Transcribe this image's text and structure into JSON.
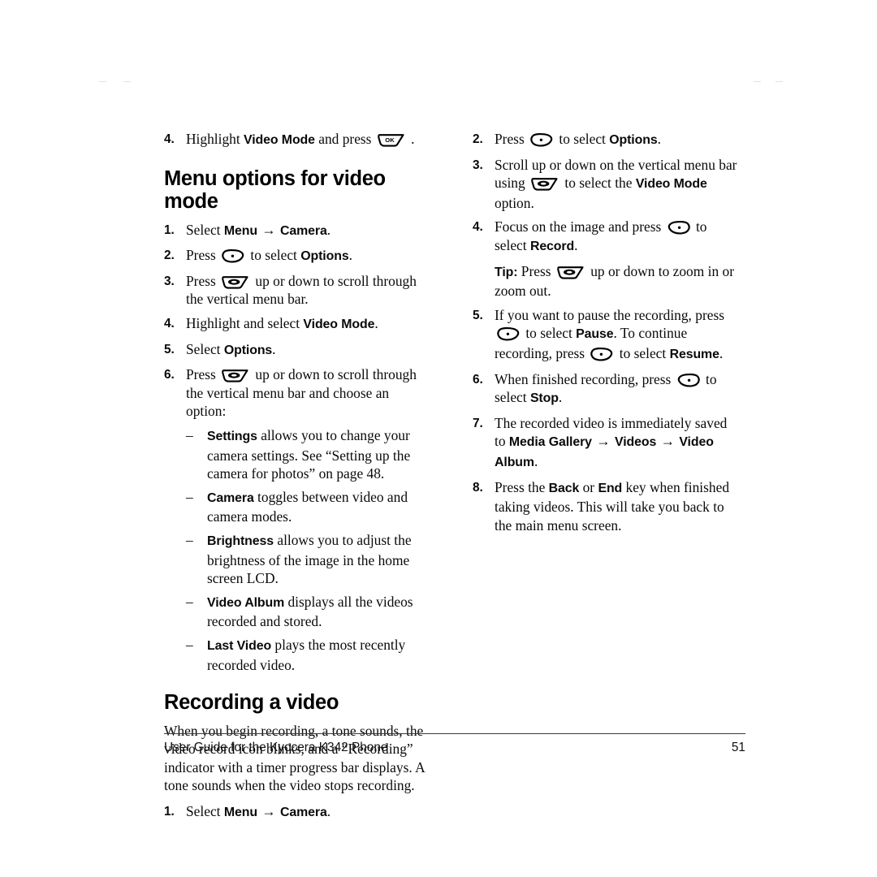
{
  "document": {
    "page_number": "51",
    "footer_text": "User Guide for the Kyocera K342 Phone"
  },
  "left_column": {
    "lead_item": {
      "number": "4.",
      "text_before": "Highlight ",
      "bold_1": "Video Mode",
      "text_mid": " and press ",
      "icon": "ok-key-icon",
      "text_after": " ."
    },
    "heading": "Menu options for video mode",
    "steps": [
      {
        "number": "1.",
        "parts": [
          {
            "t": "Select "
          },
          {
            "b": "Menu"
          },
          {
            "arrow": "→"
          },
          {
            "b": "Camera"
          },
          {
            "t": "."
          }
        ]
      },
      {
        "number": "2.",
        "parts": [
          {
            "t": "Press "
          },
          {
            "icon": "left-softkey-icon"
          },
          {
            "t": " to select "
          },
          {
            "b": "Options"
          },
          {
            "t": "."
          }
        ]
      },
      {
        "number": "3.",
        "parts": [
          {
            "t": "Press "
          },
          {
            "icon": "navigation-key-icon"
          },
          {
            "t": " up or down to scroll through the vertical menu bar."
          }
        ]
      },
      {
        "number": "4.",
        "parts": [
          {
            "t": "Highlight and select "
          },
          {
            "b": "Video Mode"
          },
          {
            "t": "."
          }
        ]
      },
      {
        "number": "5.",
        "parts": [
          {
            "t": "Select "
          },
          {
            "b": "Options"
          },
          {
            "t": "."
          }
        ]
      },
      {
        "number": "6.",
        "parts": [
          {
            "t": "Press "
          },
          {
            "icon": "navigation-key-icon"
          },
          {
            "t": " up or down to scroll through the vertical menu bar and choose an option:"
          }
        ]
      }
    ],
    "options": [
      {
        "dash": "–",
        "parts": [
          {
            "b": "Settings"
          },
          {
            "t": " allows you to change your camera settings. See “Setting up the camera for photos” on page 48."
          }
        ]
      },
      {
        "dash": "–",
        "parts": [
          {
            "b": "Camera"
          },
          {
            "t": " toggles between video and camera modes."
          }
        ]
      },
      {
        "dash": "–",
        "parts": [
          {
            "b": "Brightness"
          },
          {
            "t": " allows you to adjust the brightness of the image in the home screen LCD."
          }
        ]
      },
      {
        "dash": "–",
        "parts": [
          {
            "b": "Video Album"
          },
          {
            "t": " displays all the videos recorded and stored."
          }
        ]
      },
      {
        "dash": "–",
        "parts": [
          {
            "b": "Last Video"
          },
          {
            "t": " plays the most recently recorded video."
          }
        ]
      }
    ],
    "heading_2": "Recording a video",
    "paragraph": "When you begin recording, a tone sounds, the video record icon blinks, and a “Recording” indicator with a timer progress bar displays. A tone sounds when the video stops recording.",
    "final_step": {
      "number": "1.",
      "parts": [
        {
          "t": "Select "
        },
        {
          "b": "Menu"
        },
        {
          "arrow": "→"
        },
        {
          "b": "Camera"
        },
        {
          "t": "."
        }
      ]
    }
  },
  "right_column": {
    "steps": [
      {
        "number": "2.",
        "parts": [
          {
            "t": "Press "
          },
          {
            "icon": "left-softkey-icon"
          },
          {
            "t": " to select "
          },
          {
            "b": "Options"
          },
          {
            "t": "."
          }
        ]
      },
      {
        "number": "3.",
        "parts": [
          {
            "t": "Scroll up or down on the vertical menu bar using "
          },
          {
            "icon": "navigation-key-icon"
          },
          {
            "t": " to select the "
          },
          {
            "b": "Video Mode"
          },
          {
            "t": " option."
          }
        ]
      },
      {
        "number": "4.",
        "parts": [
          {
            "t": "Focus on the image and press "
          },
          {
            "icon": "right-softkey-icon"
          },
          {
            "t": " to select "
          },
          {
            "b": "Record"
          },
          {
            "t": "."
          }
        ]
      }
    ],
    "tip": {
      "label": "Tip:",
      "parts": [
        {
          "t": " Press "
        },
        {
          "icon": "navigation-key-icon"
        },
        {
          "t": " up or down to zoom in or zoom out."
        }
      ]
    },
    "steps_2": [
      {
        "number": "5.",
        "parts": [
          {
            "t": "If you want to pause the recording, press "
          },
          {
            "icon": "left-softkey-icon"
          },
          {
            "t": " to select "
          },
          {
            "b": "Pause"
          },
          {
            "t": ". To continue recording, press "
          },
          {
            "icon": "left-softkey-icon"
          },
          {
            "t": " to select "
          },
          {
            "b": "Resume"
          },
          {
            "t": "."
          }
        ]
      },
      {
        "number": "6.",
        "parts": [
          {
            "t": "When finished recording, press "
          },
          {
            "icon": "right-softkey-icon"
          },
          {
            "t": " to select "
          },
          {
            "b": "Stop"
          },
          {
            "t": "."
          }
        ]
      },
      {
        "number": "7.",
        "parts": [
          {
            "t": "The recorded video is immediately saved to "
          },
          {
            "b": "Media Gallery"
          },
          {
            "arrow": "→"
          },
          {
            "b": "Videos"
          },
          {
            "arrow": "→"
          },
          {
            "b": "Video Album"
          },
          {
            "t": "."
          }
        ]
      },
      {
        "number": "8.",
        "parts": [
          {
            "t": "Press the "
          },
          {
            "b": "Back"
          },
          {
            "t": " or "
          },
          {
            "b": "End"
          },
          {
            "t": " key when finished taking videos. This will take you back to the main menu screen."
          }
        ]
      }
    ]
  },
  "icons": {
    "ok-key-icon": "OK",
    "left-softkey-icon": "left soft key",
    "right-softkey-icon": "right soft key",
    "navigation-key-icon": "navigation scroll key"
  }
}
